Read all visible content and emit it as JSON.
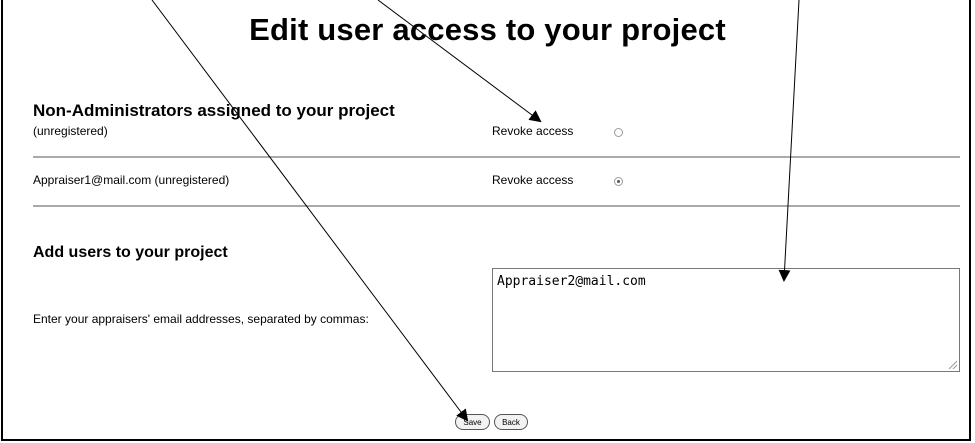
{
  "page": {
    "title": "Edit user access to your project"
  },
  "non_admins": {
    "heading": "Non-Administrators assigned to your project",
    "rows": [
      {
        "user": "(unregistered)",
        "revoke_label": "Revoke access",
        "revoke_checked": false
      },
      {
        "user": "Appraiser1@mail.com (unregistered)",
        "revoke_label": "Revoke access",
        "revoke_checked": true
      }
    ]
  },
  "add_users": {
    "heading": "Add users to your project",
    "prompt": "Enter your appraisers' email addresses, separated by commas:",
    "emails_value": "Appraiser2@mail.com"
  },
  "buttons": {
    "save_label": "Save",
    "back_label": "Back"
  }
}
